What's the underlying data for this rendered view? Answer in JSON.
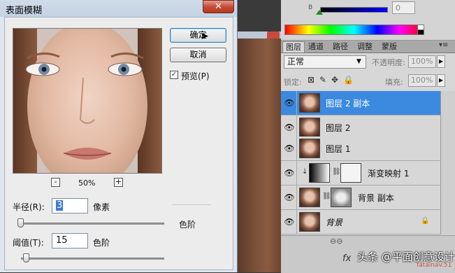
{
  "dialog": {
    "title": "表面模糊",
    "close_glyph": "✕",
    "ok_label": "确定",
    "cancel_label": "取消",
    "preview_checked": true,
    "preview_label": "预览(P)",
    "zoom_out": "-",
    "zoom_in": "+",
    "zoom_level": "50%",
    "radius_label": "半径(R):",
    "radius_value": "3",
    "radius_unit": "像素",
    "threshold_label": "阈值(T):",
    "threshold_value": "15",
    "threshold_unit": "色阶",
    "ghost_levels": "色阶"
  },
  "color_panel": {
    "channel_label": "B",
    "channel_value": "0"
  },
  "layers_panel": {
    "tabs": [
      "图层",
      "通道",
      "路径",
      "调整",
      "蒙版"
    ],
    "active_tab": 0,
    "menu_icon": "▾≡",
    "blend_mode": "正常",
    "opacity_label": "不透明度:",
    "opacity_value": "100%",
    "lock_label": "锁定:",
    "fill_label": "填充:",
    "fill_value": "100%",
    "layers": [
      {
        "name": "图层 2 副本",
        "selected": true
      },
      {
        "name": "图层 2",
        "selected": false
      },
      {
        "name": "图层 1",
        "selected": false
      },
      {
        "name": "渐变映射 1",
        "selected": false
      },
      {
        "name": "背景 副本",
        "selected": false
      },
      {
        "name": "背景",
        "selected": false
      }
    ],
    "fx_label": "fx"
  },
  "watermark": {
    "text": "头条 @平面创意设计",
    "sub": "fatainav.51"
  },
  "colors": {
    "selection": "#3c8ae0",
    "close": "#c94a3c"
  }
}
